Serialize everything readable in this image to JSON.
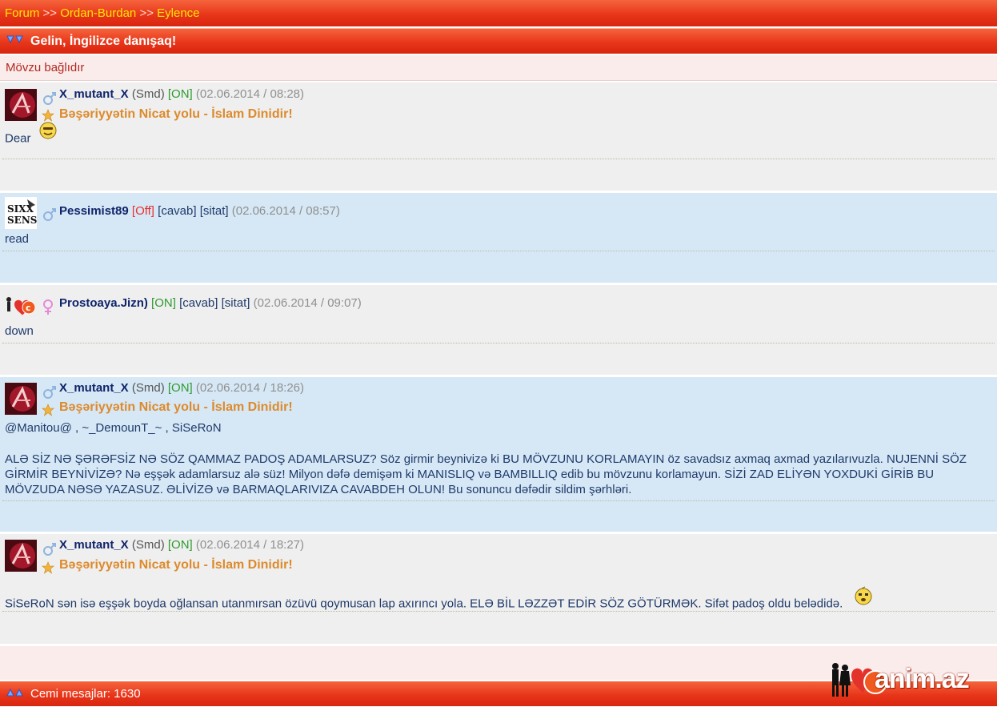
{
  "breadcrumb": {
    "forum": "Forum",
    "sep1": ">>",
    "section": "Ordan-Burdan",
    "sep2": ">>",
    "sub": "Eylence"
  },
  "topic": {
    "title": "Gelin, İngilizce danışaq!",
    "locked": "Mövzu bağlıdır"
  },
  "colors": {
    "red": "#e8361a",
    "link_yellow": "#ffe600",
    "online": "#2f9a2f",
    "offline": "#e83030",
    "status_orange": "#dd8a2c",
    "username": "#10246a"
  },
  "posts": [
    {
      "user": "X_mutant_X",
      "role": "(Smd)",
      "online": "[ON]",
      "reply": "",
      "quote": "",
      "date": "(02.06.2014 / 08:28)",
      "status": "Bəşəriyyətin Nicat yolu - İslam Dinidir!",
      "text": "Dear",
      "gender": "male-icon",
      "smiley": "smiley-icon"
    },
    {
      "user": "Pessimist89",
      "role": "",
      "online": "[Off]",
      "reply": "[cavab]",
      "quote": "[sitat]",
      "date": "(02.06.2014 / 08:57)",
      "status": "",
      "text": "read",
      "gender": "male-icon"
    },
    {
      "user": "Prostoaya.Jizn)",
      "role": "",
      "online": "[ON]",
      "reply": "[cavab]",
      "quote": "[sitat]",
      "date": "(02.06.2014 / 09:07)",
      "status": "",
      "text": "down",
      "gender": "female-icon"
    },
    {
      "user": "X_mutant_X",
      "role": "(Smd)",
      "online": "[ON]",
      "reply": "",
      "quote": "",
      "date": "(02.06.2014 / 18:26)",
      "status": "Bəşəriyyətin Nicat yolu - İslam Dinidir!",
      "mentions": "@Manitou@ , ~_DemounT_~ , SiSeRoN",
      "text": "ALƏ SİZ NƏ ŞƏRƏFSİZ NƏ SÖZ QAMMAZ PADOŞ ADAMLARSUZ? Söz girmir beynivizə ki BU MÖVZUNU KORLAMAYIN öz savadsız axmaq axmad yazılarıvuzla. NUJENNİ SÖZ GİRMİR BEYNİVİZƏ? Nə eşşək adamlarsuz alə süz! Milyon dəfə demişəm ki MANISLIQ və BAMBILLIQ edib bu mövzunu korlamayun. SİZİ ZAD ELİYƏN YOXDUKİ GİRİB BU MÖVZUDA NƏSƏ YAZASUZ. ƏLİVİZƏ və BARMAQLARIVIZA CAVABDEH OLUN! Bu sonuncu dəfədir sildim şərhləri.",
      "gender": "male-icon"
    },
    {
      "user": "X_mutant_X",
      "role": "(Smd)",
      "online": "[ON]",
      "reply": "",
      "quote": "",
      "date": "(02.06.2014 / 18:27)",
      "status": "Bəşəriyyətin Nicat yolu - İslam Dinidir!",
      "text": "SiSeRoN sən isə eşşək boyda oğlansan utanmırsan özüvü qoymusan lap axırıncı yola. ELƏ BİL LƏZZƏT EDİR SÖZ GÖTÜRMƏK. Sifət padoş oldu belədidə.",
      "gender": "male-icon",
      "smiley": "sleepy-smiley-icon"
    }
  ],
  "footer": {
    "messages": "Cemi mesajlar: 1630",
    "logo": "anim.az"
  }
}
